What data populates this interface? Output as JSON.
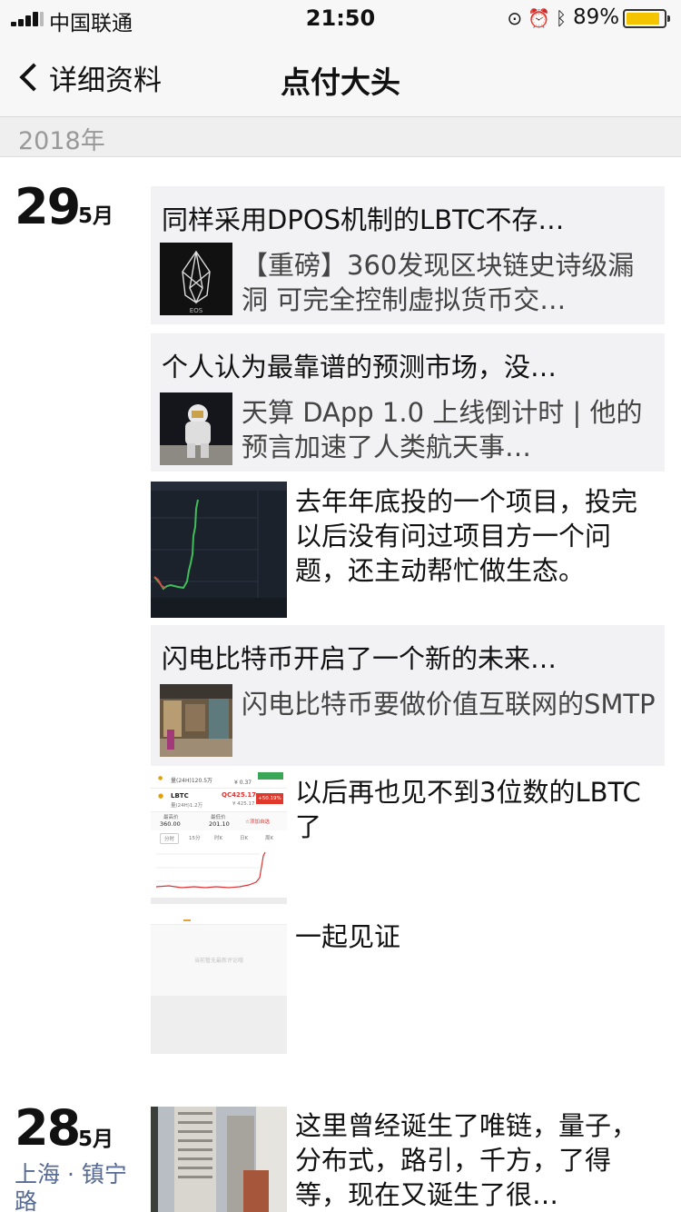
{
  "status_bar": {
    "carrier": "中国联通",
    "time": "21:50",
    "battery": "89%",
    "battery_level": 0.89
  },
  "nav": {
    "back_label": "详细资料",
    "title": "点付大头"
  },
  "year": "2018年",
  "groups": [
    {
      "day": "29",
      "month": "5月",
      "posts": [
        {
          "type": "share",
          "title": "同样采用DPOS机制的LBTC不存…",
          "thumb_label": "EOS",
          "desc": "【重磅】360发现区块链史诗级漏洞 可完全控制虚拟货币交…"
        },
        {
          "type": "share",
          "title": "个人认为最靠谱的预测市场，没…",
          "desc": "天算 DApp 1.0 上线倒计时 | 他的预言加速了人类航天事…"
        },
        {
          "type": "photo",
          "text": "去年年底投的一个项目，投完以后没有问过项目方一个问题，还主动帮忙做生态。"
        },
        {
          "type": "share",
          "title": "闪电比特币开启了一个新的未来…",
          "desc": "闪电比特币要做价值互联网的SMTP"
        },
        {
          "type": "photo",
          "text": "以后再也见不到3位数的LBTC了",
          "screenshot": {
            "row1_label": "量(24H)120.5万",
            "row1_price": "¥ 0.37",
            "ticker": "LBTC",
            "volume": "量(24H)1.2万",
            "price": "QC425.17",
            "price_cny": "¥ 425.17",
            "change": "+50.19%",
            "high_label": "最高价",
            "high": "360.00",
            "low_label": "最低价",
            "low": "201.10",
            "add_label": "添加自选",
            "tabs": [
              "分时",
              "15分",
              "时K",
              "日K",
              "周K"
            ]
          }
        },
        {
          "type": "photo",
          "text": "一起见证",
          "blank_text": "当前暂无最新评论哦"
        }
      ]
    },
    {
      "day": "28",
      "month": "5月",
      "location": "上海 · 镇宁路",
      "posts": [
        {
          "type": "photo",
          "text": "这里曾经诞生了唯链，量子，分布式，路引，千方，了得等，现在又诞生了很…"
        }
      ]
    }
  ]
}
